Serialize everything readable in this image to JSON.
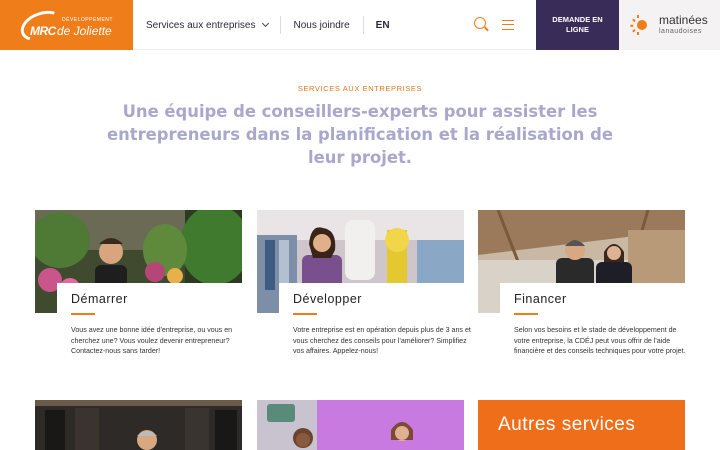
{
  "header": {
    "logo": {
      "top_text": "DÉVELOPPEMENT",
      "mrc": "MRC",
      "name": "de Joliette"
    },
    "nav": [
      {
        "label": "Services aux entreprises"
      },
      {
        "label": "Nous joindre"
      },
      {
        "label": "EN"
      }
    ],
    "cta_label": "DEMANDE EN LIGNE",
    "partner": {
      "name": "matinées",
      "sub": "lanaudoises"
    },
    "icons": {
      "search": "search-icon",
      "menu": "hamburger-menu-icon"
    },
    "colors": {
      "accent": "#ef7d1a",
      "dark": "#3a2c58",
      "headline": "#aaa7cc"
    }
  },
  "hero": {
    "kicker": "SERVICES AUX ENTREPRISES",
    "headline": "Une équipe de conseillers-experts pour assister les entrepreneurs dans la planification et la réalisation de leur projet."
  },
  "cards": [
    {
      "title": "Démarrer",
      "description": "Vous avez une bonne idée d'entreprise, ou vous en cherchez une? Vous voulez devenir entrepreneur? Contactez-nous sans tarder!"
    },
    {
      "title": "Développer",
      "description": "Votre entreprise est en opération depuis plus de 3 ans et vous cherchez des conseils pour l'améliorer? Simplifiez vos affaires. Appelez-nous!"
    },
    {
      "title": "Financer",
      "description": "Selon vos besoins et le stade de développement de votre entreprise, la CDÉJ peut vous offrir de l'aide financière et des conseils techniques pour votre projet."
    }
  ],
  "more": {
    "label": "Autres services"
  }
}
